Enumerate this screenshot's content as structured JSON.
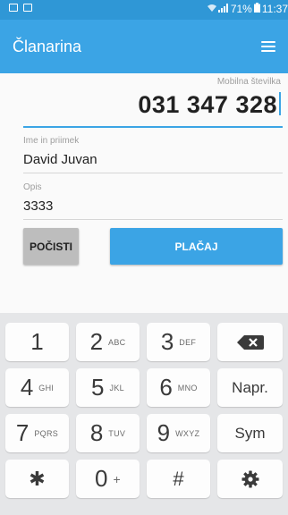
{
  "status_bar": {
    "battery": "71%",
    "time": "11:37"
  },
  "app_bar": {
    "title": "Članarina"
  },
  "form": {
    "phone_label": "Mobilna številka",
    "phone_value": "031 347 328",
    "name_label": "Ime in priimek",
    "name_value": "David Juvan",
    "desc_label": "Opis",
    "desc_value": "3333"
  },
  "buttons": {
    "clear": "POČISTI",
    "pay": "PLAČAJ"
  },
  "keyboard": {
    "k1": "1",
    "k2": "2",
    "k2_sub": "ABC",
    "k3": "3",
    "k3_sub": "DEF",
    "k4": "4",
    "k4_sub": "GHI",
    "k5": "5",
    "k5_sub": "JKL",
    "k6": "6",
    "k6_sub": "MNO",
    "next": "Napr.",
    "k7": "7",
    "k7_sub": "PQRS",
    "k8": "8",
    "k8_sub": "TUV",
    "k9": "9",
    "k9_sub": "WXYZ",
    "sym": "Sym",
    "star": "✱",
    "k0": "0",
    "k0_sub": "+",
    "hash": "#"
  }
}
